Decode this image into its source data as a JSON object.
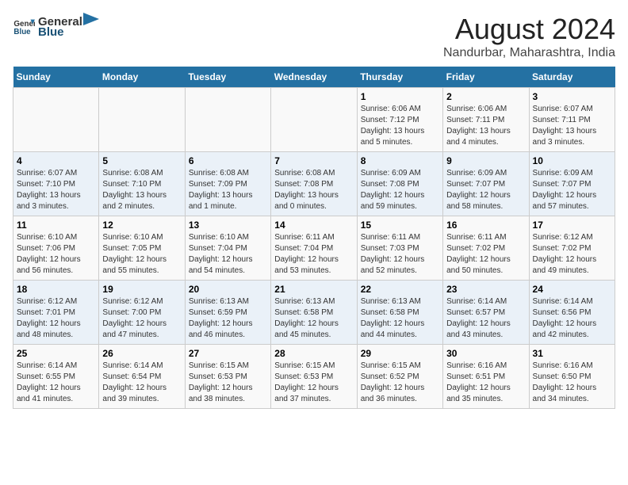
{
  "header": {
    "logo_general": "General",
    "logo_blue": "Blue",
    "title": "August 2024",
    "subtitle": "Nandurbar, Maharashtra, India"
  },
  "days_of_week": [
    "Sunday",
    "Monday",
    "Tuesday",
    "Wednesday",
    "Thursday",
    "Friday",
    "Saturday"
  ],
  "weeks": [
    [
      {
        "day": "",
        "info": ""
      },
      {
        "day": "",
        "info": ""
      },
      {
        "day": "",
        "info": ""
      },
      {
        "day": "",
        "info": ""
      },
      {
        "day": "1",
        "info": "Sunrise: 6:06 AM\nSunset: 7:12 PM\nDaylight: 13 hours and 5 minutes."
      },
      {
        "day": "2",
        "info": "Sunrise: 6:06 AM\nSunset: 7:11 PM\nDaylight: 13 hours and 4 minutes."
      },
      {
        "day": "3",
        "info": "Sunrise: 6:07 AM\nSunset: 7:11 PM\nDaylight: 13 hours and 3 minutes."
      }
    ],
    [
      {
        "day": "4",
        "info": "Sunrise: 6:07 AM\nSunset: 7:10 PM\nDaylight: 13 hours and 3 minutes."
      },
      {
        "day": "5",
        "info": "Sunrise: 6:08 AM\nSunset: 7:10 PM\nDaylight: 13 hours and 2 minutes."
      },
      {
        "day": "6",
        "info": "Sunrise: 6:08 AM\nSunset: 7:09 PM\nDaylight: 13 hours and 1 minute."
      },
      {
        "day": "7",
        "info": "Sunrise: 6:08 AM\nSunset: 7:08 PM\nDaylight: 13 hours and 0 minutes."
      },
      {
        "day": "8",
        "info": "Sunrise: 6:09 AM\nSunset: 7:08 PM\nDaylight: 12 hours and 59 minutes."
      },
      {
        "day": "9",
        "info": "Sunrise: 6:09 AM\nSunset: 7:07 PM\nDaylight: 12 hours and 58 minutes."
      },
      {
        "day": "10",
        "info": "Sunrise: 6:09 AM\nSunset: 7:07 PM\nDaylight: 12 hours and 57 minutes."
      }
    ],
    [
      {
        "day": "11",
        "info": "Sunrise: 6:10 AM\nSunset: 7:06 PM\nDaylight: 12 hours and 56 minutes."
      },
      {
        "day": "12",
        "info": "Sunrise: 6:10 AM\nSunset: 7:05 PM\nDaylight: 12 hours and 55 minutes."
      },
      {
        "day": "13",
        "info": "Sunrise: 6:10 AM\nSunset: 7:04 PM\nDaylight: 12 hours and 54 minutes."
      },
      {
        "day": "14",
        "info": "Sunrise: 6:11 AM\nSunset: 7:04 PM\nDaylight: 12 hours and 53 minutes."
      },
      {
        "day": "15",
        "info": "Sunrise: 6:11 AM\nSunset: 7:03 PM\nDaylight: 12 hours and 52 minutes."
      },
      {
        "day": "16",
        "info": "Sunrise: 6:11 AM\nSunset: 7:02 PM\nDaylight: 12 hours and 50 minutes."
      },
      {
        "day": "17",
        "info": "Sunrise: 6:12 AM\nSunset: 7:02 PM\nDaylight: 12 hours and 49 minutes."
      }
    ],
    [
      {
        "day": "18",
        "info": "Sunrise: 6:12 AM\nSunset: 7:01 PM\nDaylight: 12 hours and 48 minutes."
      },
      {
        "day": "19",
        "info": "Sunrise: 6:12 AM\nSunset: 7:00 PM\nDaylight: 12 hours and 47 minutes."
      },
      {
        "day": "20",
        "info": "Sunrise: 6:13 AM\nSunset: 6:59 PM\nDaylight: 12 hours and 46 minutes."
      },
      {
        "day": "21",
        "info": "Sunrise: 6:13 AM\nSunset: 6:58 PM\nDaylight: 12 hours and 45 minutes."
      },
      {
        "day": "22",
        "info": "Sunrise: 6:13 AM\nSunset: 6:58 PM\nDaylight: 12 hours and 44 minutes."
      },
      {
        "day": "23",
        "info": "Sunrise: 6:14 AM\nSunset: 6:57 PM\nDaylight: 12 hours and 43 minutes."
      },
      {
        "day": "24",
        "info": "Sunrise: 6:14 AM\nSunset: 6:56 PM\nDaylight: 12 hours and 42 minutes."
      }
    ],
    [
      {
        "day": "25",
        "info": "Sunrise: 6:14 AM\nSunset: 6:55 PM\nDaylight: 12 hours and 41 minutes."
      },
      {
        "day": "26",
        "info": "Sunrise: 6:14 AM\nSunset: 6:54 PM\nDaylight: 12 hours and 39 minutes."
      },
      {
        "day": "27",
        "info": "Sunrise: 6:15 AM\nSunset: 6:53 PM\nDaylight: 12 hours and 38 minutes."
      },
      {
        "day": "28",
        "info": "Sunrise: 6:15 AM\nSunset: 6:53 PM\nDaylight: 12 hours and 37 minutes."
      },
      {
        "day": "29",
        "info": "Sunrise: 6:15 AM\nSunset: 6:52 PM\nDaylight: 12 hours and 36 minutes."
      },
      {
        "day": "30",
        "info": "Sunrise: 6:16 AM\nSunset: 6:51 PM\nDaylight: 12 hours and 35 minutes."
      },
      {
        "day": "31",
        "info": "Sunrise: 6:16 AM\nSunset: 6:50 PM\nDaylight: 12 hours and 34 minutes."
      }
    ]
  ]
}
